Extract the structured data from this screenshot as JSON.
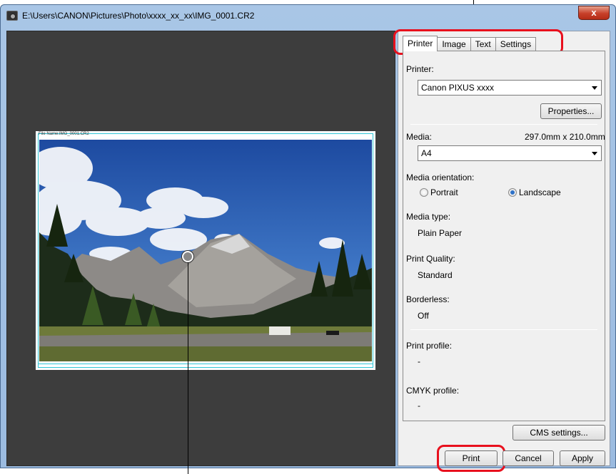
{
  "window": {
    "title": "E:\\Users\\CANON\\Pictures\\Photo\\xxxx_xx_xx\\IMG_0001.CR2",
    "close_label": "x"
  },
  "preview": {
    "file_name": "File Name:IMG_0001.CR2"
  },
  "tabs": [
    "Printer",
    "Image",
    "Text",
    "Settings"
  ],
  "printer_tab": {
    "printer_label": "Printer:",
    "printer_value": "Canon PIXUS xxxx",
    "properties_button": "Properties...",
    "media_label": "Media:",
    "media_size": "297.0mm x 210.0mm",
    "media_value": "A4",
    "orientation_label": "Media orientation:",
    "portrait_label": "Portrait",
    "landscape_label": "Landscape",
    "media_type_label": "Media type:",
    "media_type_value": "Plain Paper",
    "print_quality_label": "Print Quality:",
    "print_quality_value": "Standard",
    "borderless_label": "Borderless:",
    "borderless_value": "Off",
    "print_profile_label": "Print profile:",
    "print_profile_value": "-",
    "cmyk_profile_label": "CMYK profile:",
    "cmyk_profile_value": "-",
    "cms_settings_button": "CMS settings..."
  },
  "footer": {
    "print_button": "Print",
    "cancel_button": "Cancel",
    "apply_button": "Apply"
  },
  "colors": {
    "highlight": "#e8101d",
    "print_frame": "#2fc6d6",
    "preview_bg": "#3d3d3d"
  }
}
